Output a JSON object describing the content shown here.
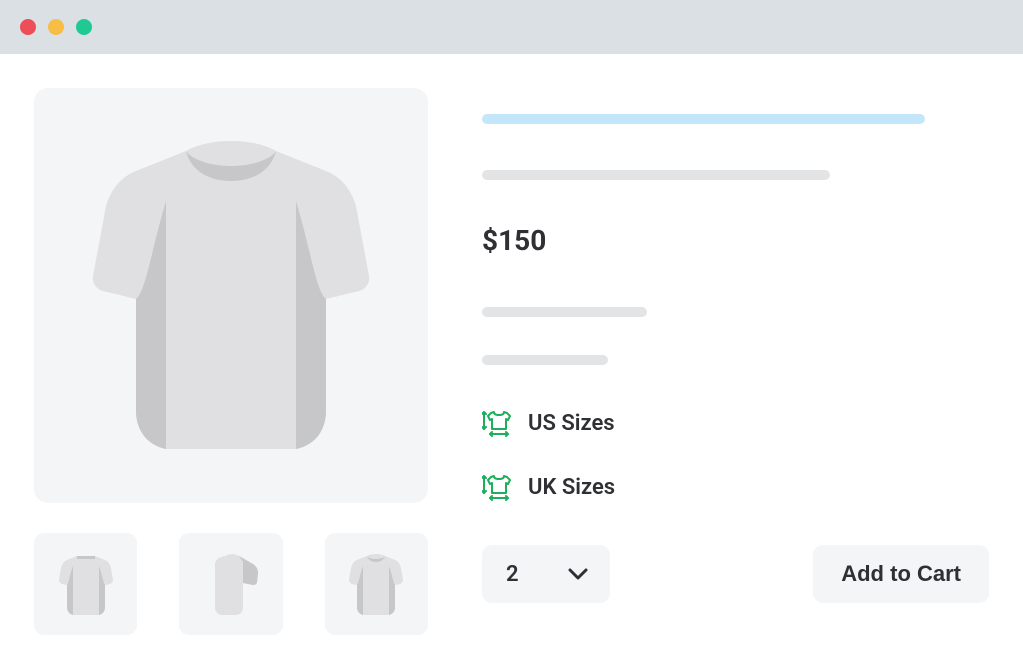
{
  "traffic_colors": {
    "red": "#ed4e58",
    "yellow": "#f7bd45",
    "green": "#1fc991"
  },
  "price": "$150",
  "size_options": [
    {
      "label": "US Sizes"
    },
    {
      "label": "UK Sizes"
    }
  ],
  "quantity": "2",
  "add_to_cart_label": "Add to Cart",
  "accent_green": "#1fae5b"
}
